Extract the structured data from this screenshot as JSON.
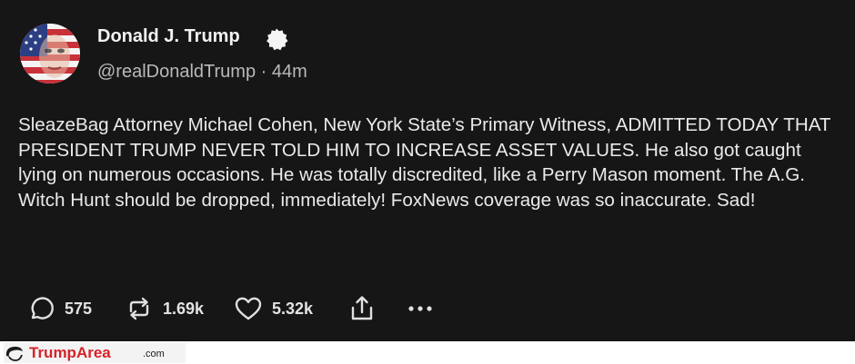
{
  "post": {
    "author_name": "Donald J. Trump",
    "handle": "@realDonaldTrump",
    "separator": "·",
    "time": "44m",
    "text": "SleazeBag Attorney Michael Cohen, New York State’s Primary Witness, ADMITTED TODAY THAT PRESIDENT TRUMP NEVER TOLD HIM TO INCREASE ASSET VALUES. He also got caught lying on numerous occasions. He was totally discredited, like a Perry Mason moment. The A.G. Witch Hunt should be dropped, immediately! FoxNews coverage was so inaccurate. Sad!"
  },
  "actions": {
    "replies": "575",
    "reposts": "1.69k",
    "likes": "5.32k",
    "share_icon": "share-icon",
    "more_icon": "more-icon"
  },
  "watermark": {
    "brand": "TrumpArea",
    "suffix": ".com",
    "brand_color": "#d5232a"
  },
  "colors": {
    "background": "#161616",
    "text": "#ececec",
    "muted": "#b9b9b9"
  }
}
